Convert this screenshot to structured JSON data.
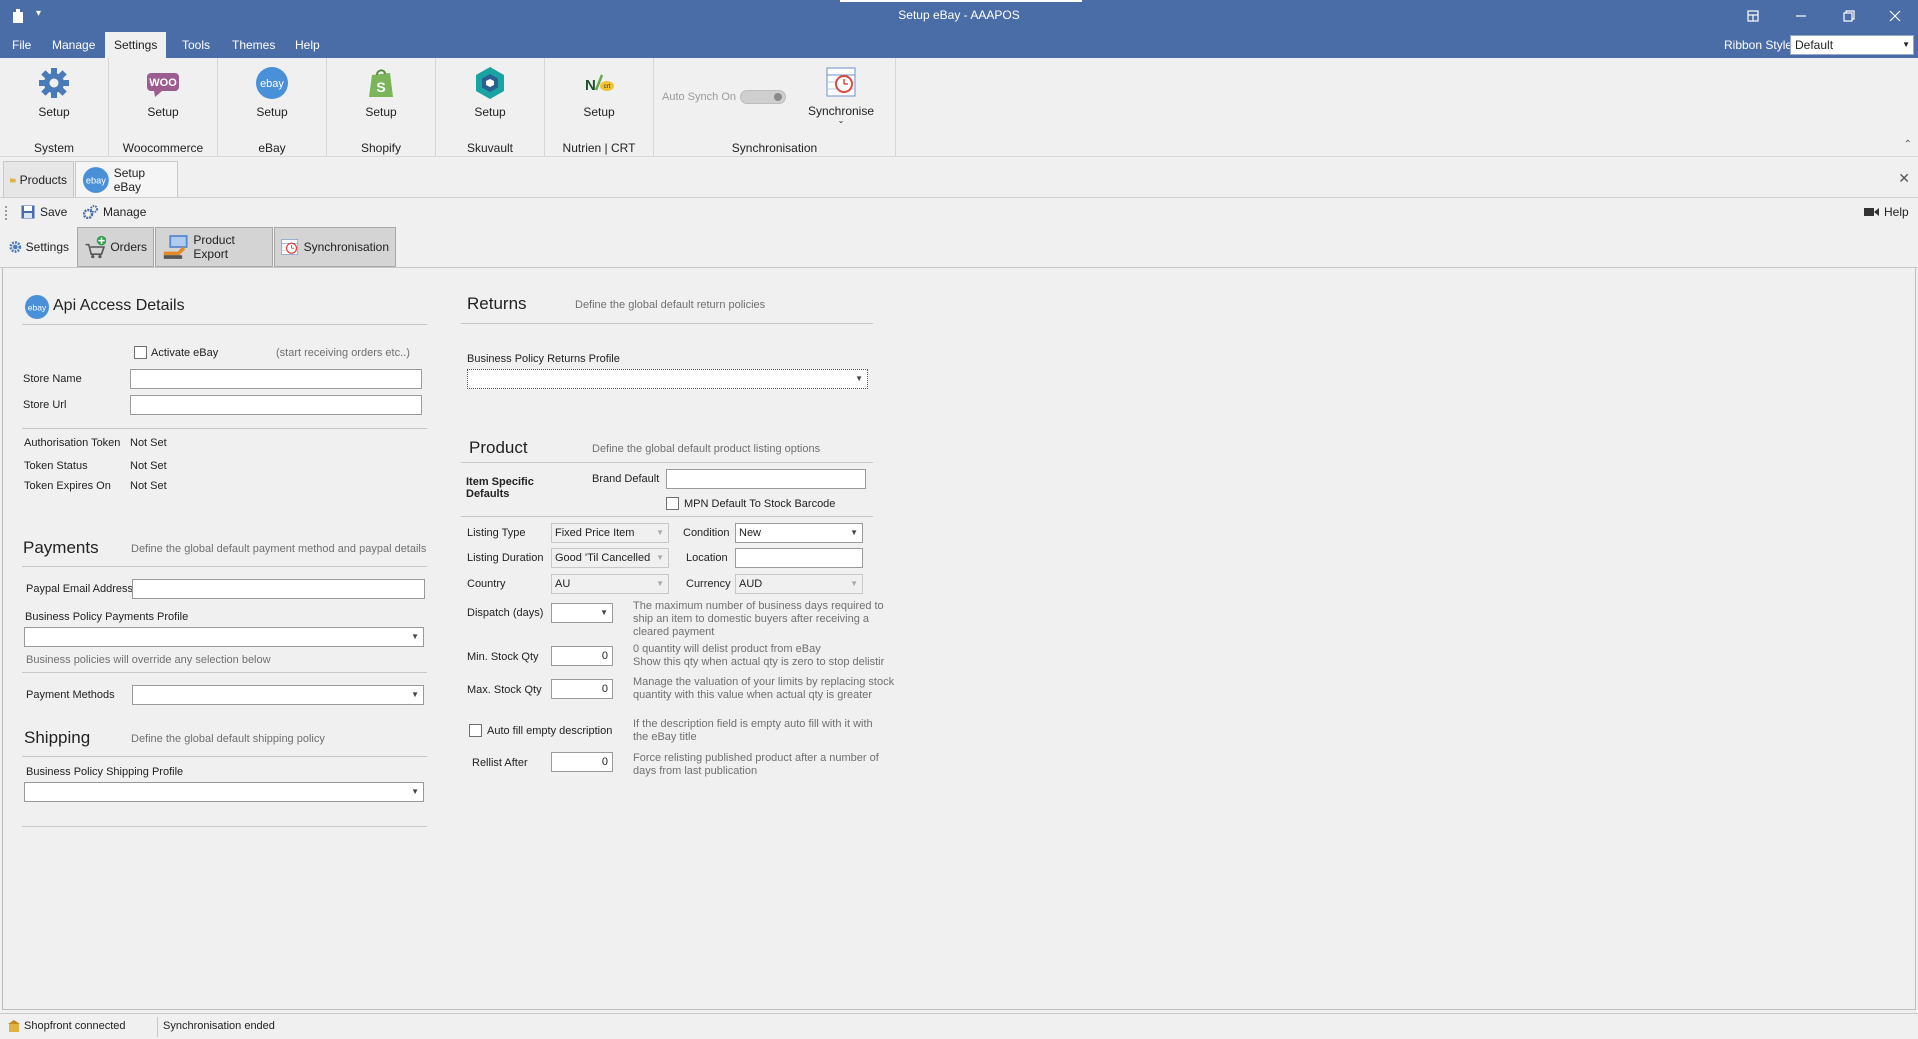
{
  "window": {
    "title": "Setup eBay - AAAPOS"
  },
  "menu": {
    "items": [
      "File",
      "Manage",
      "Settings",
      "Tools",
      "Themes",
      "Help"
    ],
    "active": "Settings",
    "ribbon_style_label": "Ribbon Style",
    "ribbon_style_value": "Default"
  },
  "ribbon": {
    "groups": [
      {
        "button": "Setup",
        "name": "System"
      },
      {
        "button": "Setup",
        "name": "Woocommerce"
      },
      {
        "button": "Setup",
        "name": "eBay"
      },
      {
        "button": "Setup",
        "name": "Shopify"
      },
      {
        "button": "Setup",
        "name": "Skuvault"
      },
      {
        "button": "Setup",
        "name": "Nutrien | CRT"
      }
    ],
    "sync_group": {
      "auto_synch_label": "Auto Synch On",
      "button": "Synchronise",
      "name": "Synchronisation"
    }
  },
  "doc_tabs": [
    {
      "label": "Products"
    },
    {
      "label": "Setup eBay",
      "active": true
    }
  ],
  "toolbar": {
    "save": "Save",
    "manage": "Manage",
    "help": "Help"
  },
  "sub_tabs": [
    "Settings",
    "Orders",
    "Product Export",
    "Synchronisation"
  ],
  "api": {
    "title": "Api Access Details",
    "activate_label": "Activate eBay",
    "activate_hint": "(start receiving orders etc..)",
    "store_name_label": "Store Name",
    "store_url_label": "Store Url",
    "auth_token_label": "Authorisation Token",
    "auth_token_value": "Not Set",
    "token_status_label": "Token Status",
    "token_status_value": "Not Set",
    "token_expires_label": "Token Expires On",
    "token_expires_value": "Not Set"
  },
  "payments": {
    "title": "Payments",
    "desc": "Define the global default payment method and paypal details",
    "paypal_label": "Paypal Email Address",
    "policy_label": "Business Policy Payments Profile",
    "policy_hint": "Business policies will override any selection below",
    "methods_label": "Payment Methods"
  },
  "shipping": {
    "title": "Shipping",
    "desc": "Define the global default shipping policy",
    "policy_label": "Business Policy Shipping Profile"
  },
  "returns": {
    "title": "Returns",
    "desc": "Define the global default return policies",
    "policy_label": "Business Policy Returns Profile"
  },
  "product": {
    "title": "Product",
    "desc": "Define the global default product listing options",
    "item_specific_line1": "Item Specific",
    "item_specific_line2": "Defaults",
    "brand_label": "Brand Default",
    "mpn_label": "MPN Default To Stock Barcode",
    "listing_type_label": "Listing Type",
    "listing_type_value": "Fixed Price Item",
    "condition_label": "Condition",
    "condition_value": "New",
    "listing_duration_label": "Listing Duration",
    "listing_duration_value": "Good 'Til Cancelled",
    "location_label": "Location",
    "country_label": "Country",
    "country_value": "AU",
    "currency_label": "Currency",
    "currency_value": "AUD",
    "dispatch_label": "Dispatch (days)",
    "dispatch_hint1": "The maximum number of business days required to",
    "dispatch_hint2": "ship an item to domestic buyers after receiving a",
    "dispatch_hint3": "cleared payment",
    "min_stock_label": "Min. Stock Qty",
    "min_stock_value": "0",
    "min_stock_hint1": "0 quantity will delist product from eBay",
    "min_stock_hint2": "Show this qty when actual qty is zero to stop delistir",
    "max_stock_label": "Max. Stock Qty",
    "max_stock_value": "0",
    "max_stock_hint1": "Manage the valuation of your limits by replacing stock",
    "max_stock_hint2": "quantity with this value when actual qty is greater",
    "autofill_label": "Auto fill empty description",
    "autofill_hint1": "If the description field is empty auto fill with it with",
    "autofill_hint2": "the eBay title",
    "relist_label": "Rellist After",
    "relist_value": "0",
    "relist_hint1": "Force relisting published product after a number of",
    "relist_hint2": "days from last publication"
  },
  "status": {
    "left": "Shopfront connected",
    "right": "Synchronisation ended"
  }
}
